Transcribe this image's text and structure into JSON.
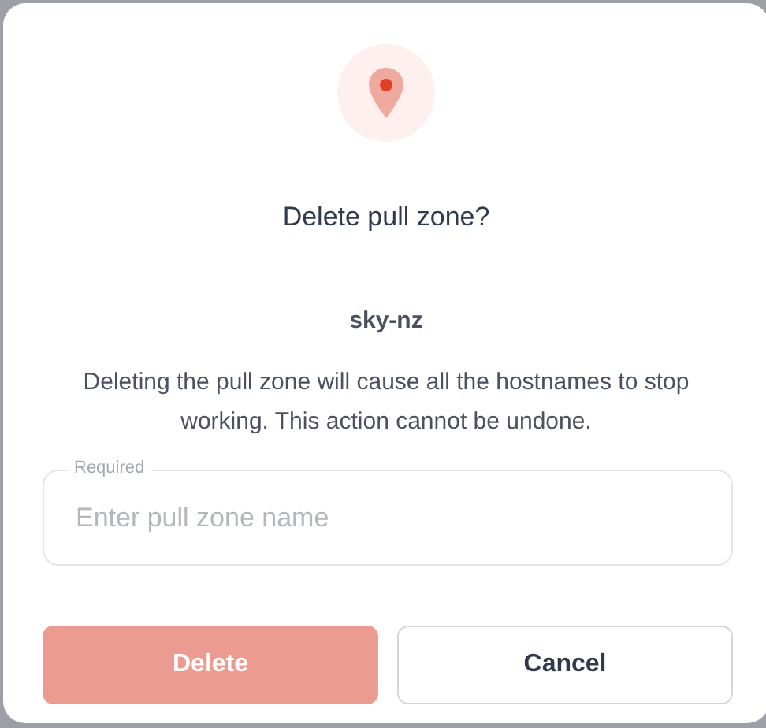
{
  "dialog": {
    "title": "Delete pull zone?",
    "zone_name": "sky-nz",
    "message": "Deleting the pull zone will cause all the hostnames to stop working. This action cannot be undone.",
    "field": {
      "label": "Required",
      "placeholder": "Enter pull zone name"
    },
    "buttons": [
      {
        "label": "Delete",
        "kind": "danger",
        "disabled": true
      },
      {
        "label": "Cancel",
        "kind": "secondary",
        "disabled": false
      }
    ]
  }
}
